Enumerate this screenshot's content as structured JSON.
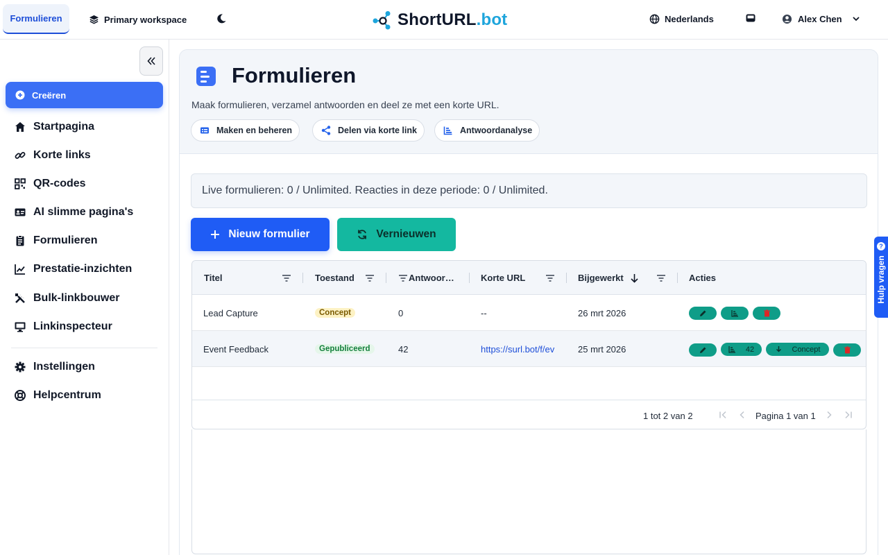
{
  "topbar": {
    "active_tab": "Formulieren",
    "workspace": "Primary workspace",
    "logo_main": "ShortURL",
    "logo_accent": ".bot",
    "language": "Nederlands",
    "user": "Alex Chen"
  },
  "sidebar": {
    "create": "Creëren",
    "items": [
      {
        "label": "Startpagina",
        "icon": "home-icon"
      },
      {
        "label": "Korte links",
        "icon": "link-icon"
      },
      {
        "label": "QR-codes",
        "icon": "qr-icon"
      },
      {
        "label": "AI slimme pagina's",
        "icon": "id-card-icon"
      },
      {
        "label": "Formulieren",
        "icon": "clipboard-icon"
      },
      {
        "label": "Prestatie-inzichten",
        "icon": "chart-line-icon"
      },
      {
        "label": "Bulk-linkbouwer",
        "icon": "tools-icon"
      },
      {
        "label": "Linkinspecteur",
        "icon": "monitor-icon"
      }
    ],
    "bottom_items": [
      {
        "label": "Instellingen",
        "icon": "gear-icon"
      },
      {
        "label": "Helpcentrum",
        "icon": "lifebuoy-icon"
      }
    ]
  },
  "main": {
    "title": "Formulieren",
    "subtitle": "Maak formulieren, verzamel antwoorden en deel ze met een korte URL.",
    "chips": [
      "Maken en beheren",
      "Delen via korte link",
      "Antwoordanalyse"
    ],
    "notice": "Live formulieren: 0 / Unlimited. Reacties in deze periode: 0 / Unlimited.",
    "btn_new": "Nieuw formulier",
    "btn_refresh": "Vernieuwen"
  },
  "table": {
    "headers": [
      "Titel",
      "Toestand",
      "Antwoor…",
      "Korte URL",
      "Bijgewerkt",
      "Acties"
    ],
    "rows": [
      {
        "title": "Lead Capture",
        "status": "Concept",
        "answers": "0",
        "url": "--",
        "updated": "26 mrt 2026"
      },
      {
        "title": "Event Feedback",
        "status": "Gepubliceerd",
        "answers": "42",
        "url": "https://surl.bot/f/ev",
        "updated": "25 mrt 2026",
        "count": "42",
        "download": "Concept"
      }
    ],
    "footer_range": "1 tot 2 van 2",
    "footer_page": "Pagina 1 van 1"
  },
  "help": {
    "label": "Hulp vragen"
  },
  "colors": {
    "primary": "#1f5cf5",
    "teal": "#14b8a0",
    "accent": "#1ea5dc"
  }
}
